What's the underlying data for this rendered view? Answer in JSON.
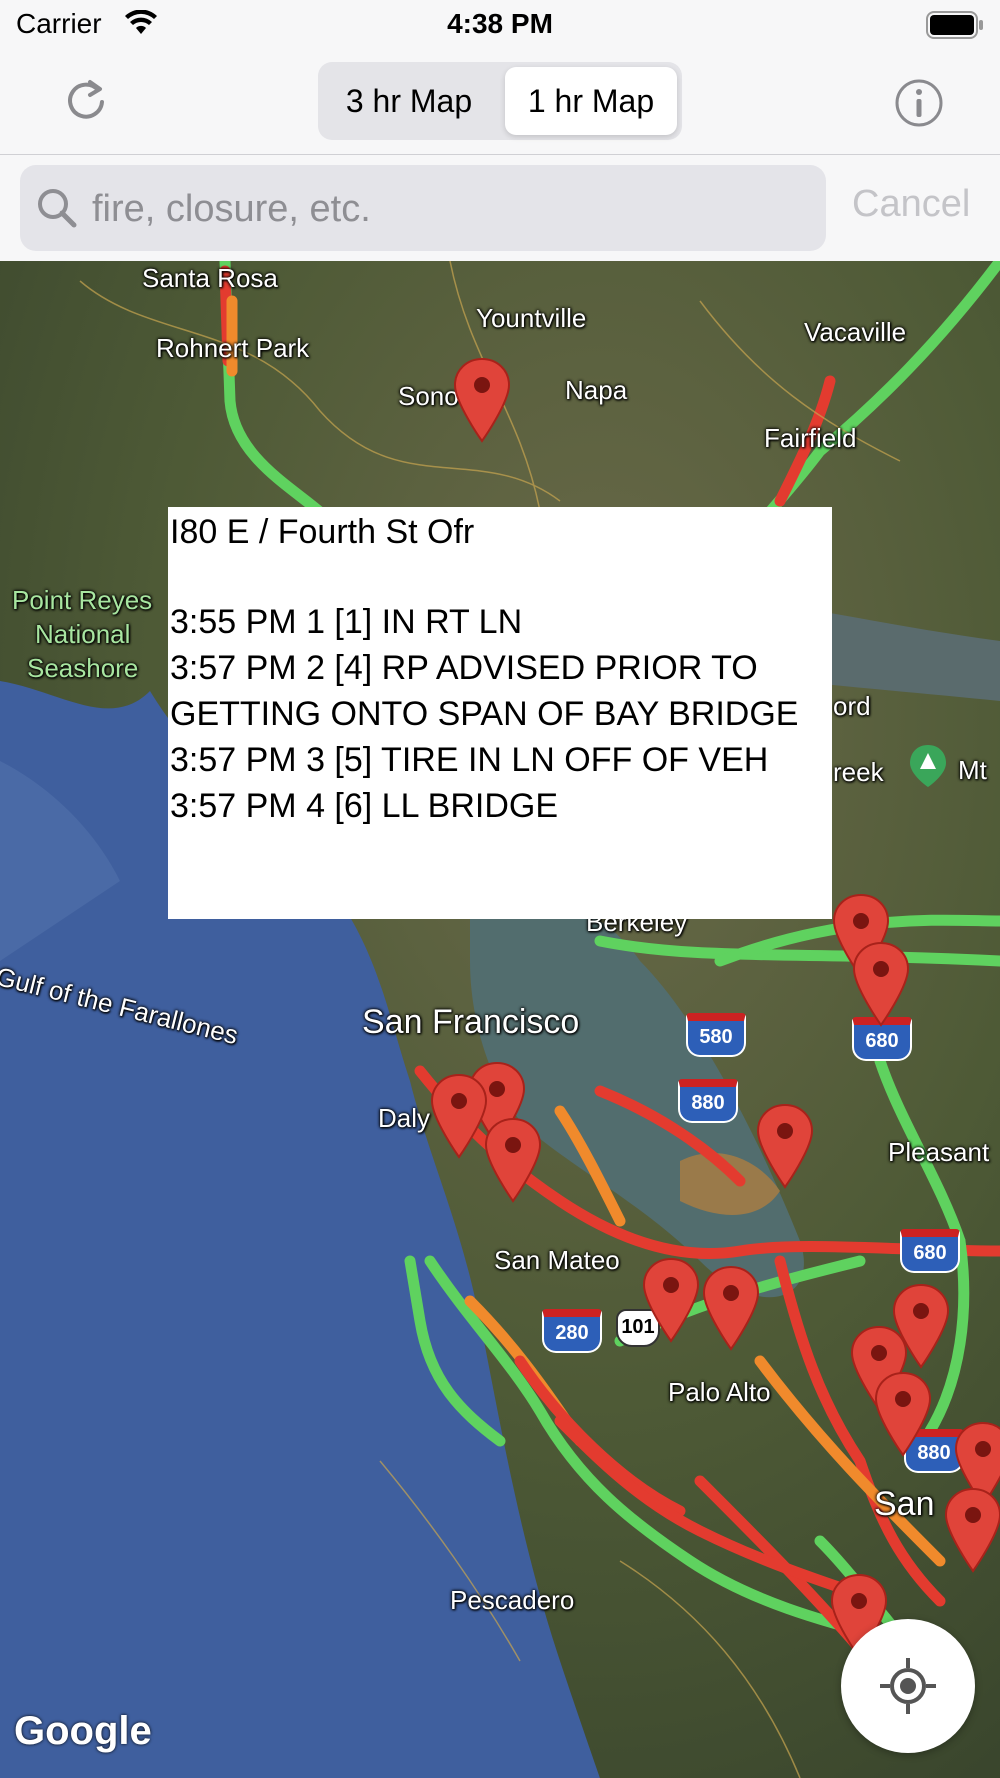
{
  "status_bar": {
    "carrier": "Carrier",
    "time": "4:38 PM"
  },
  "nav": {
    "segments": [
      "3 hr Map",
      "1 hr Map"
    ],
    "selected_segment": "1 hr Map"
  },
  "search": {
    "placeholder": "fire, closure, etc.",
    "value": "",
    "cancel_label": "Cancel"
  },
  "map": {
    "labels": {
      "santa_rosa": "Santa Rosa",
      "yountville": "Yountville",
      "rohnert_park": "Rohnert Park",
      "vacaville": "Vacaville",
      "sonoma": "Sono",
      "napa": "Napa",
      "fairfield": "Fairfield",
      "point_reyes": "Point Reyes",
      "national": "National",
      "seashore": "Seashore",
      "concord": "ord",
      "creek": "reek",
      "mt": "Mt",
      "berkeley": "Berkeley",
      "gulf": "Gulf of the Farallones",
      "san_francisco": "San Francisco",
      "daly": "Daly",
      "pleasanton": "Pleasant",
      "san_mateo": "San Mateo",
      "palo_alto": "Palo Alto",
      "san_jose": "San",
      "pescadero": "Pescadero"
    },
    "shields": {
      "i580": "580",
      "i880a": "880",
      "i680a": "680",
      "i880b": "880",
      "i680b": "680",
      "i280": "280",
      "us101": "101",
      "i880c": "880"
    },
    "google_logo": "Google"
  },
  "popup": {
    "title": "I80 E / Fourth St Ofr",
    "lines": [
      "3:55 PM 1 [1] IN RT LN",
      "3:57 PM 2 [4] RP ADVISED PRIOR TO GETTING ONTO SPAN OF BAY BRIDGE",
      "3:57 PM 3 [5] TIRE IN LN OFF OF VEH",
      "3:57 PM 4 [6] LL BRIDGE"
    ]
  },
  "colors": {
    "pin": "#e0443a",
    "traffic_green": "#5fd25f",
    "traffic_red": "#e33b2f",
    "traffic_orange": "#f08a2c",
    "water": "#3f5f9e"
  },
  "icons": {
    "refresh": "refresh-icon",
    "info": "info-icon",
    "search": "search-icon",
    "locate": "locate-icon"
  }
}
